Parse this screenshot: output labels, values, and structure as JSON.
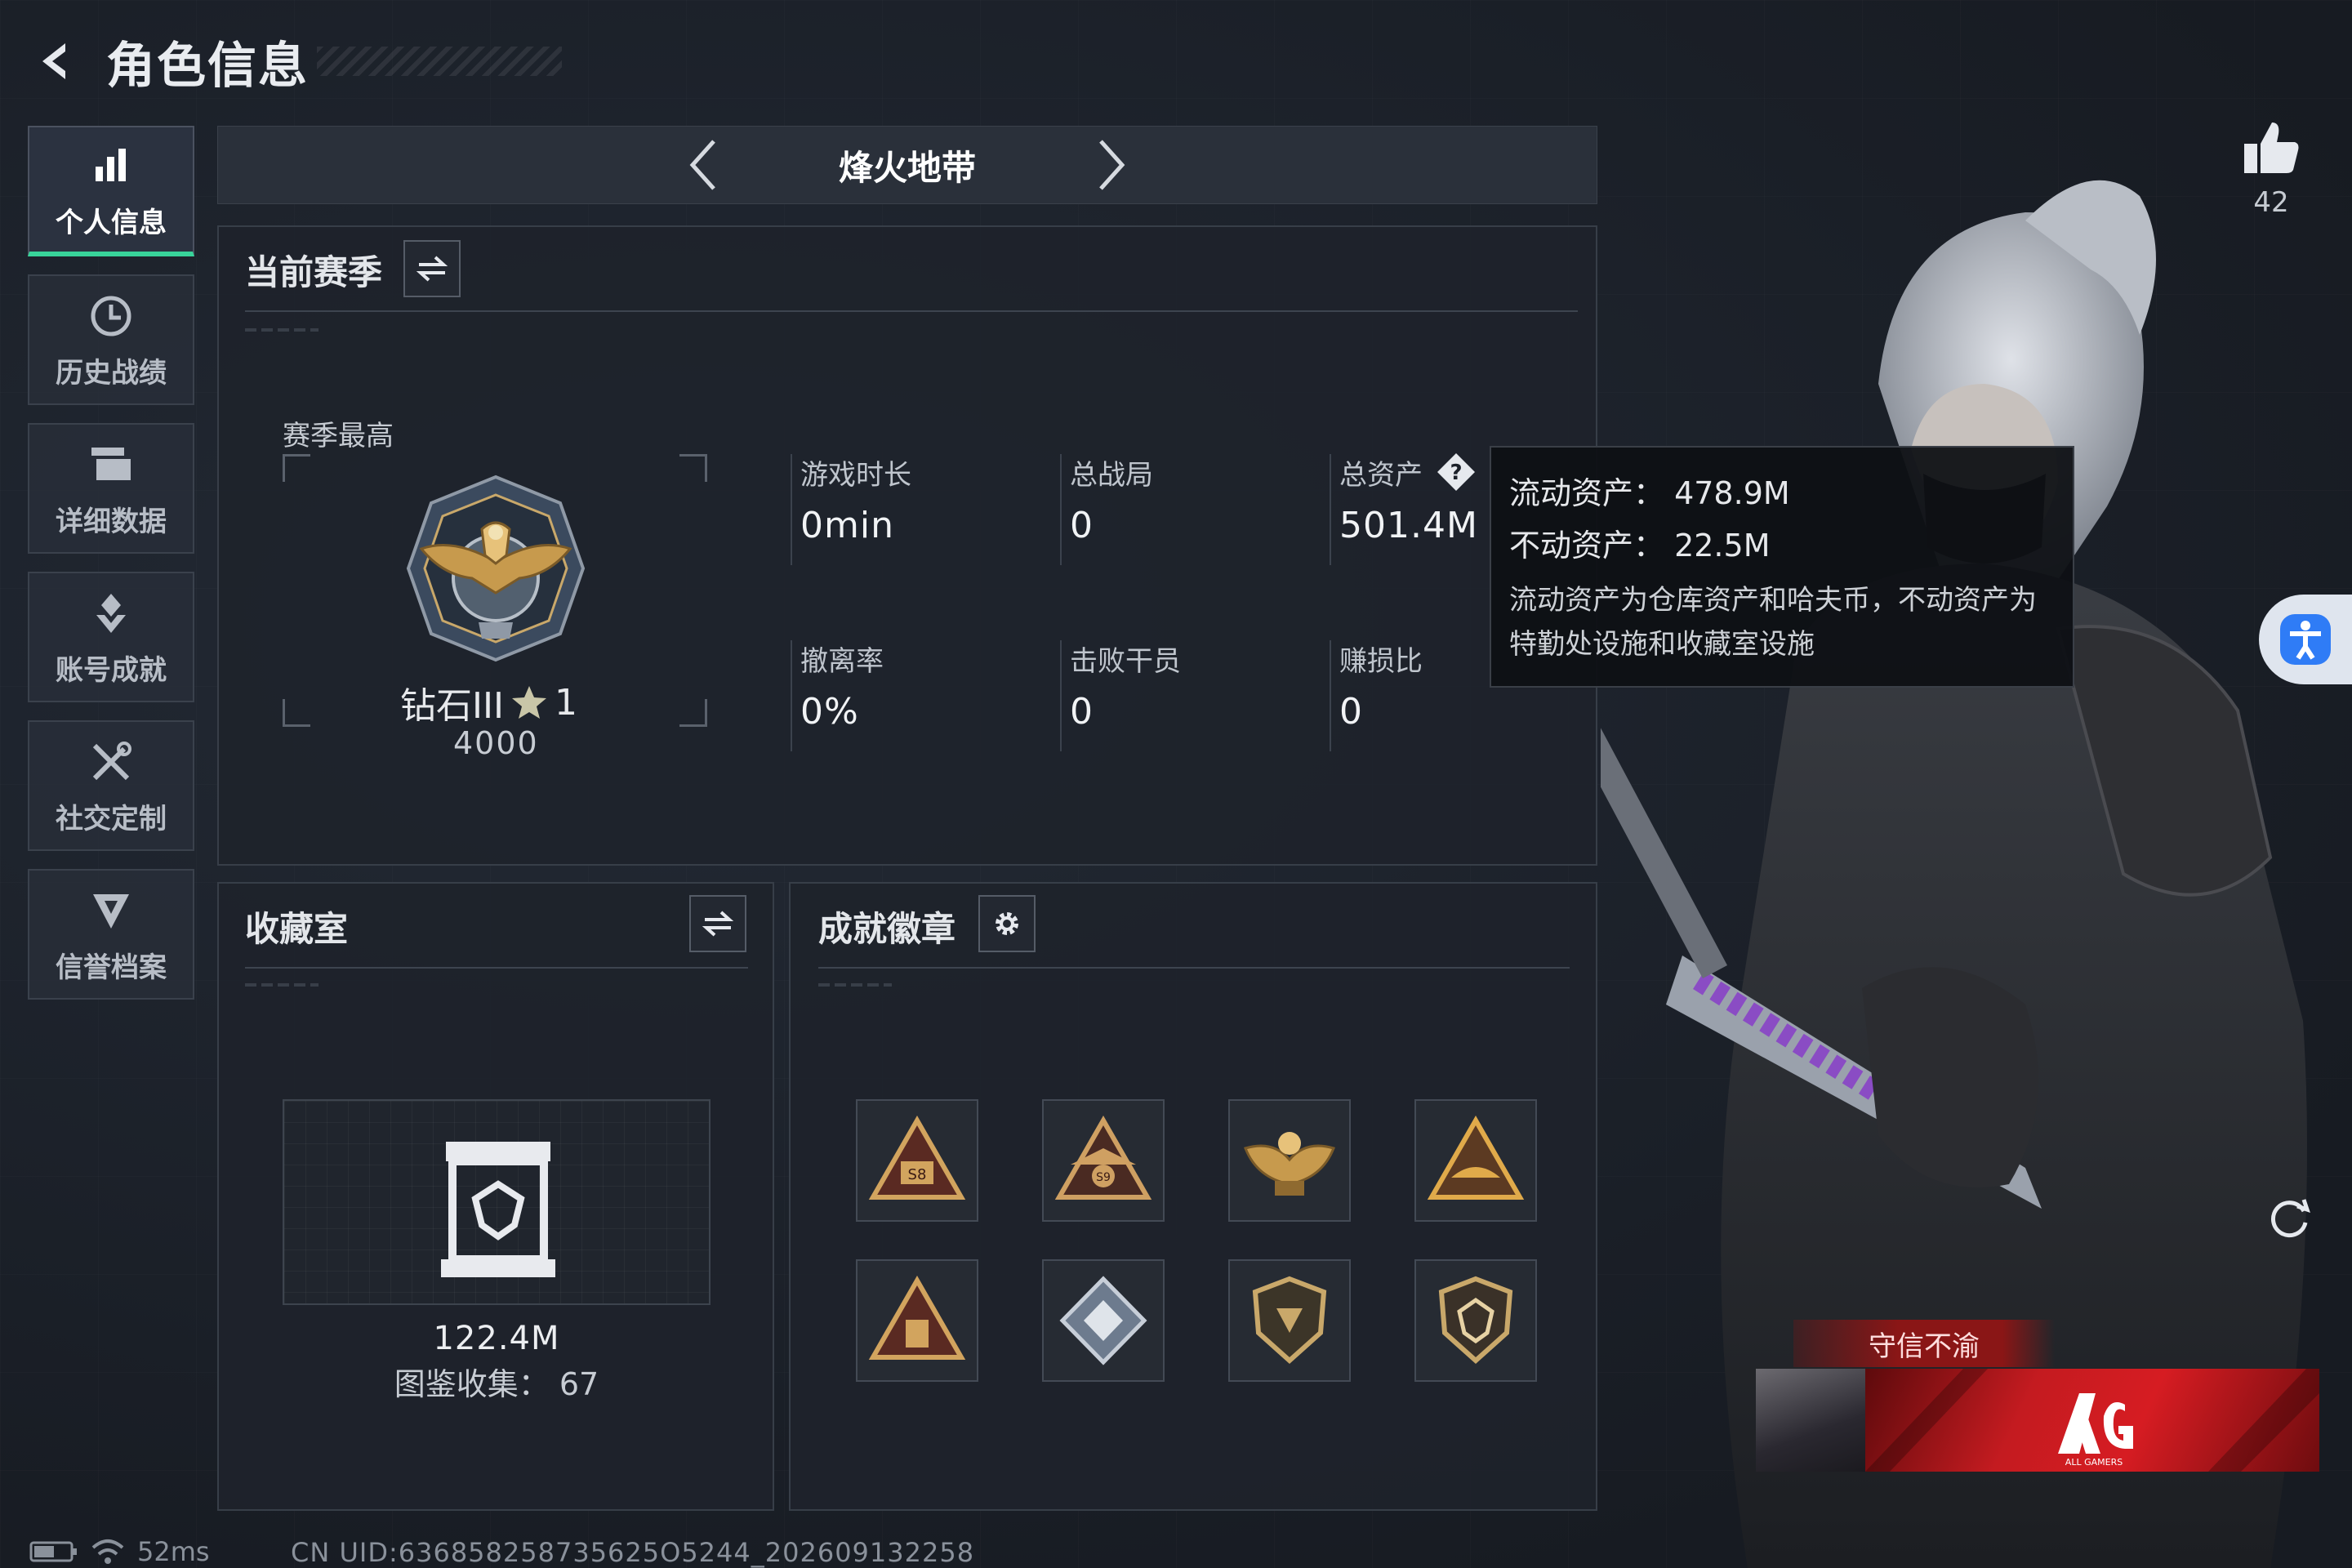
{
  "header": {
    "title": "角色信息"
  },
  "sidebar": {
    "items": [
      {
        "label": "个人信息",
        "icon": "bar-chart-icon",
        "active": true
      },
      {
        "label": "历史战绩",
        "icon": "history-clock-icon",
        "active": false
      },
      {
        "label": "详细数据",
        "icon": "data-stack-icon",
        "active": false
      },
      {
        "label": "账号成就",
        "icon": "achievement-icon",
        "active": false
      },
      {
        "label": "社交定制",
        "icon": "tools-icon",
        "active": false
      },
      {
        "label": "信誉档案",
        "icon": "reputation-icon",
        "active": false
      }
    ],
    "active_color": "#38d39a"
  },
  "mode_selector": {
    "label": "烽火地带"
  },
  "current_season": {
    "title": "当前赛季",
    "season_best_label": "赛季最高",
    "rank": {
      "name": "钻石III",
      "stars": "1",
      "score": "4000"
    },
    "stats": [
      {
        "label": "游戏时长",
        "value": "0min"
      },
      {
        "label": "总战局",
        "value": "0"
      },
      {
        "label": "总资产",
        "value": "501.4M"
      },
      {
        "label": "撤离率",
        "value": "0%"
      },
      {
        "label": "击败干员",
        "value": "0"
      },
      {
        "label": "赚损比",
        "value": "0"
      }
    ]
  },
  "tooltip": {
    "liquid": "流动资产：  478.9M",
    "fixed": "不动资产：  22.5M",
    "note": "流动资产为仓库资产和哈夫币，不动资产为特勤处设施和收藏室设施"
  },
  "collection": {
    "title": "收藏室",
    "value": "122.4M",
    "count_text": "图鉴收集：  67"
  },
  "achievements": {
    "title": "成就徽章",
    "badges": [
      {
        "icon": "s8-badge-icon"
      },
      {
        "icon": "s9-badge-icon"
      },
      {
        "icon": "s10-eagle-badge-icon"
      },
      {
        "icon": "triangle-badge-icon"
      },
      {
        "icon": "pyramid-badge-icon"
      },
      {
        "icon": "diamond-badge-icon"
      },
      {
        "icon": "shield-badge-icon"
      },
      {
        "icon": "gem-shield-badge-icon"
      }
    ]
  },
  "likes": {
    "count": "42"
  },
  "nameplate": {
    "title": "守信不渝",
    "team_logo": "AG",
    "team_subtitle": "ALL GAMERS"
  },
  "status": {
    "ping": "52ms",
    "uid": "CN UID:636858258735625O5244_202609132258"
  }
}
